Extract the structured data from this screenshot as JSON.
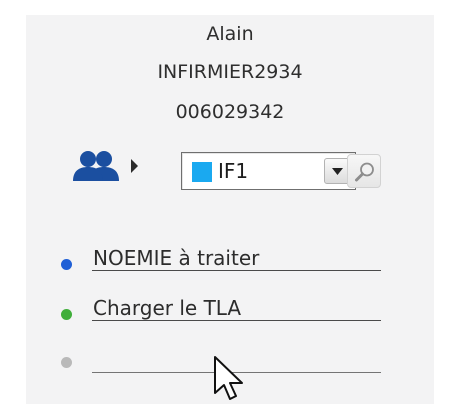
{
  "user": {
    "name": "Alain",
    "role": "INFIRMIER2934",
    "id": "006029342"
  },
  "team_selector": {
    "icon": "users-icon",
    "arrow_icon": "caret-right-icon",
    "selected": "IF1",
    "selected_color": "#1aa9f0",
    "dropdown_icon": "chevron-down-icon",
    "search_icon": "search-icon"
  },
  "actions": [
    {
      "label": "NOEMIE à traiter",
      "dot_color": "#1f5fd6"
    },
    {
      "label": "Charger le TLA",
      "dot_color": "#3fae3a"
    },
    {
      "label": "",
      "dot_color": "#b9b9b9"
    }
  ],
  "colors": {
    "panel_bg": "#f3f3f4",
    "users_icon": "#1b4fa0",
    "text": "#2e2e2e"
  }
}
